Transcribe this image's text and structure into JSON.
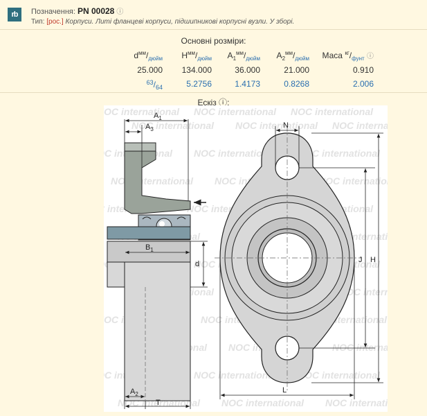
{
  "header": {
    "logo_text": "rb",
    "designation_label": "Позначення:",
    "designation_code": "PN 00028",
    "info_mark": "ⓘ",
    "type_label": "Тип:",
    "type_link": "[рос.]",
    "type_description": "Корпуси. Литі фланцеві корпуси, підшипникові корпусні вузли. У зборі."
  },
  "dimensions": {
    "title": "Основні розміри:",
    "columns": [
      {
        "symbol": "d",
        "unit_top": "мм",
        "unit_bottom": "дюйм",
        "metric": "25.000",
        "imperial_num": "63",
        "imperial_den": "64"
      },
      {
        "symbol": "H",
        "unit_top": "мм",
        "unit_bottom": "дюйм",
        "metric": "134.000",
        "imperial": "5.2756"
      },
      {
        "symbol": "A1",
        "unit_top": "мм",
        "unit_bottom": "дюйм",
        "metric": "36.000",
        "imperial": "1.4173"
      },
      {
        "symbol": "A2",
        "unit_top": "мм",
        "unit_bottom": "дюйм",
        "metric": "21.000",
        "imperial": "0.8268"
      },
      {
        "symbol": "Маса",
        "unit_top": "кг",
        "unit_bottom": "фунт",
        "metric": "0.910",
        "imperial": "2.006",
        "info_mark": "ⓘ"
      }
    ]
  },
  "sketch": {
    "title": "Ескіз ⓘ:",
    "watermark_text": "NOC international",
    "labels": {
      "A1": "A",
      "A1_sub": "1",
      "A3": "A",
      "A3_sub": "3",
      "B1": "B",
      "B1_sub": "1",
      "A2": "A",
      "A2_sub": "2",
      "T": "T",
      "d": "d",
      "N": "N",
      "J": "J",
      "H": "H",
      "L": "L"
    }
  },
  "colors": {
    "background": "#fff8e1",
    "housing_gray": "#c9c9c9",
    "housing_dark": "#9aa39a",
    "link_red": "#c0392b",
    "imperial_blue": "#2a6fb0"
  }
}
